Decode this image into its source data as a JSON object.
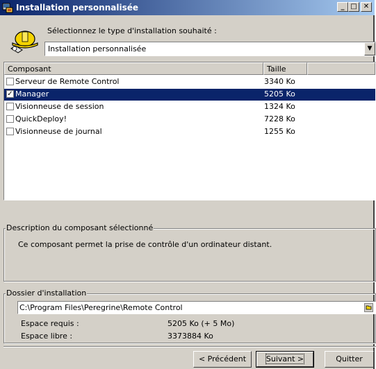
{
  "window": {
    "title": "Installation personnalisée",
    "minimize_glyph": "_",
    "maximize_glyph": "□",
    "close_glyph": "✕"
  },
  "header": {
    "icon": "hardhat-install-icon",
    "prompt": "Sélectionnez le type d'installation souhaité :",
    "install_type": "Installation personnalisée"
  },
  "components": {
    "columns": [
      "Composant",
      "Taille"
    ],
    "rows": [
      {
        "name": "Serveur de Remote Control",
        "size": "3340 Ko",
        "checked": false,
        "selected": false
      },
      {
        "name": "Manager",
        "size": "5205 Ko",
        "checked": true,
        "selected": true
      },
      {
        "name": "Visionneuse de session",
        "size": "1324 Ko",
        "checked": false,
        "selected": false
      },
      {
        "name": "QuickDeploy!",
        "size": "7228 Ko",
        "checked": false,
        "selected": false
      },
      {
        "name": "Visionneuse de journal",
        "size": "1255 Ko",
        "checked": false,
        "selected": false
      }
    ]
  },
  "description": {
    "title": "Description du composant sélectionné",
    "text": "Ce composant permet la prise de contrôle d'un ordinateur distant."
  },
  "folder": {
    "title": "Dossier d'installation",
    "path": "C:\\Program Files\\Peregrine\\Remote Control",
    "required_label": "Espace requis :",
    "required_value": "5205 Ko (+ 5 Mo)",
    "free_label": "Espace libre :",
    "free_value": "3373884 Ko"
  },
  "buttons": {
    "back": "< Précédent",
    "next": "Suivant >",
    "quit": "Quitter"
  },
  "colors": {
    "titlebar_start": "#0a246a",
    "titlebar_end": "#a6caf0",
    "selection": "#0a246a",
    "face": "#d4d0c8"
  }
}
